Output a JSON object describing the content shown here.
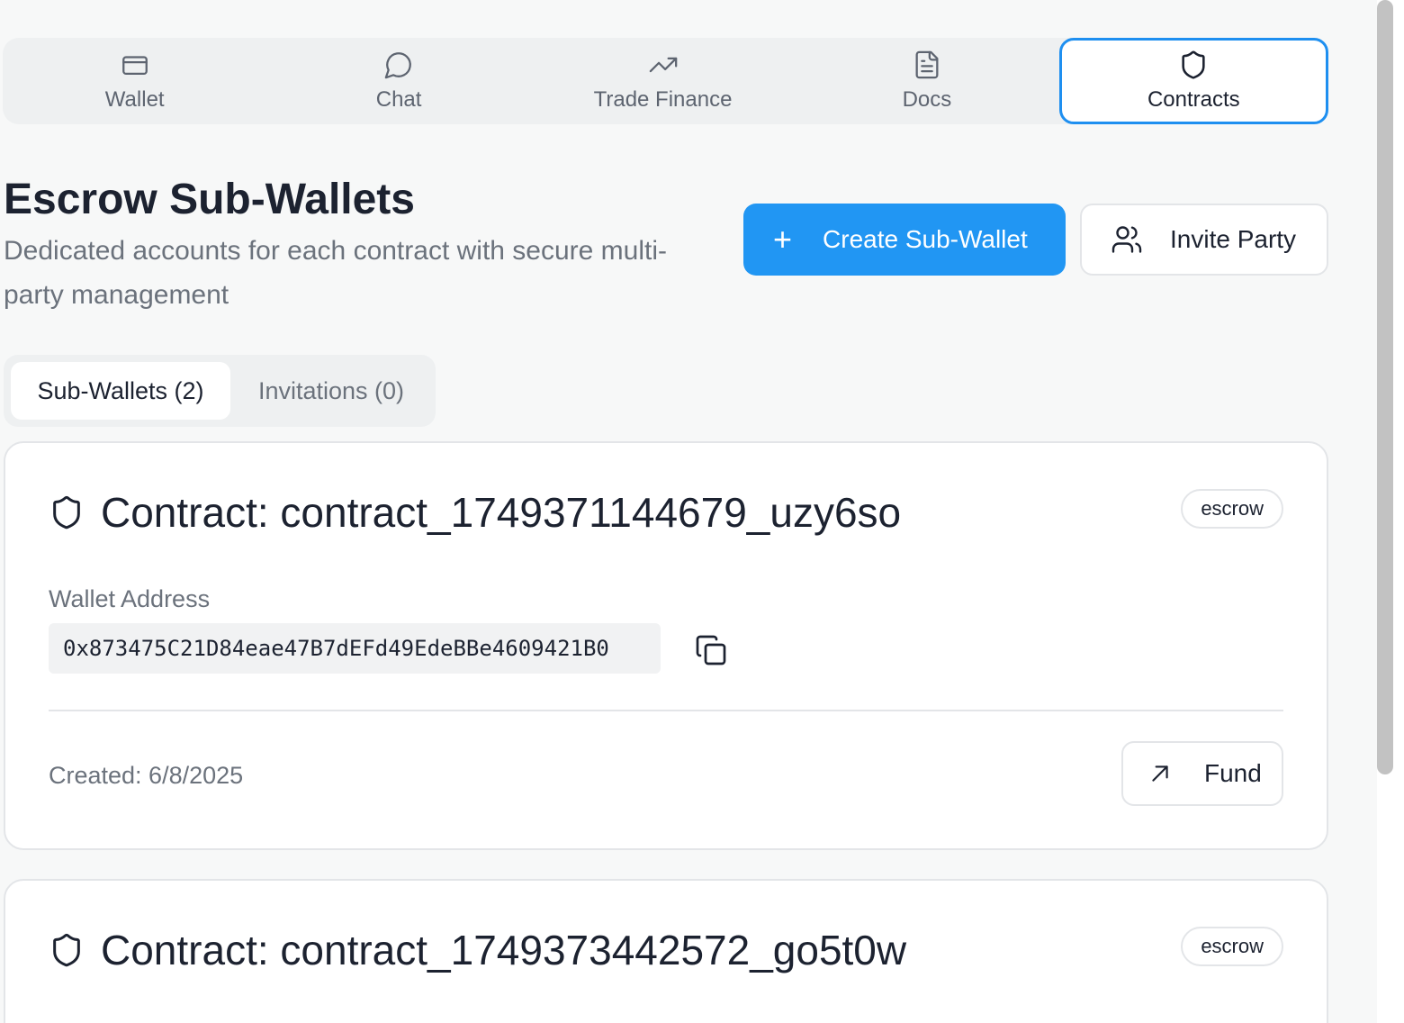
{
  "nav": {
    "tabs": [
      {
        "label": "Wallet",
        "icon": "wallet-icon"
      },
      {
        "label": "Chat",
        "icon": "chat-bubble-icon"
      },
      {
        "label": "Trade Finance",
        "icon": "trending-up-icon"
      },
      {
        "label": "Docs",
        "icon": "document-icon"
      },
      {
        "label": "Contracts",
        "icon": "shield-icon",
        "active": true
      }
    ]
  },
  "header": {
    "title": "Escrow Sub-Wallets",
    "subtitle": "Dedicated accounts for each contract with secure multi-party management",
    "create_label": "Create Sub-Wallet",
    "invite_label": "Invite Party"
  },
  "subtabs": {
    "sub_wallets": "Sub-Wallets (2)",
    "invitations": "Invitations (0)"
  },
  "cards": [
    {
      "title": "Contract: contract_1749371144679_uzy6so",
      "badge": "escrow",
      "address_label": "Wallet Address",
      "address": "0x873475C21D84eae47B7dEFd49EdeBBe4609421B0",
      "created": "Created: 6/8/2025",
      "fund_label": "Fund"
    },
    {
      "title": "Contract: contract_1749373442572_go5t0w",
      "badge": "escrow"
    }
  ],
  "colors": {
    "accent": "#2196f3",
    "active_border": "#1e8ff0"
  }
}
